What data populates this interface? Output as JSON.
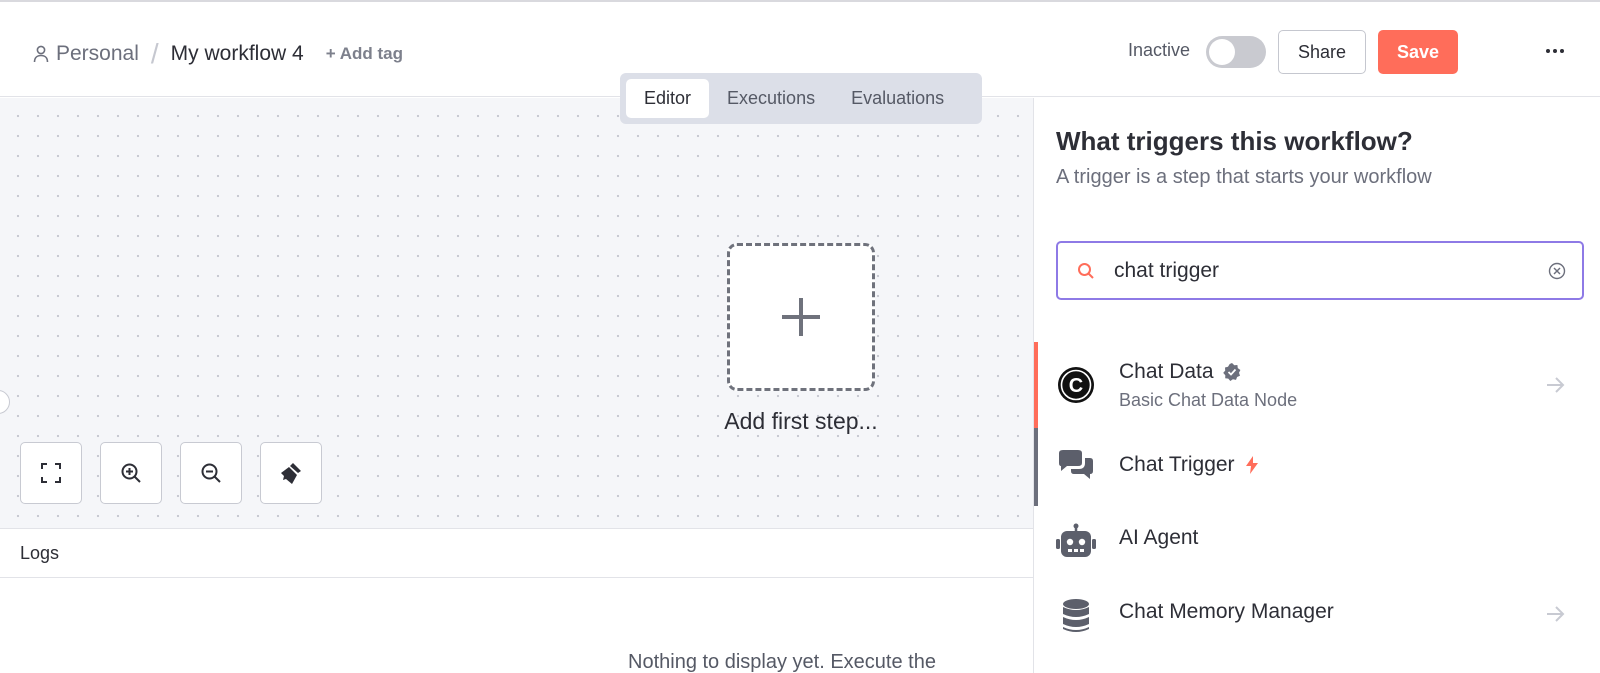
{
  "header": {
    "project": "Personal",
    "workflow_name": "My workflow 4",
    "add_tag": "+ Add tag",
    "status_label": "Inactive",
    "share_label": "Share",
    "save_label": "Save"
  },
  "tabs": [
    {
      "label": "Editor",
      "active": true
    },
    {
      "label": "Executions",
      "active": false
    },
    {
      "label": "Evaluations",
      "active": false
    }
  ],
  "canvas": {
    "add_first_step": "Add first step..."
  },
  "logs": {
    "title": "Logs",
    "empty_text": "Nothing to display yet. Execute the"
  },
  "panel": {
    "title": "What triggers this workflow?",
    "subtitle": "A trigger is a step that starts your workflow",
    "search_value": "chat trigger",
    "results": [
      {
        "name": "Chat Data",
        "description": "Basic Chat Data Node",
        "icon": "chat-data-logo-icon",
        "badge": "verified-icon"
      },
      {
        "name": "Chat Trigger",
        "description": "",
        "icon": "chat-bubbles-icon",
        "badge": "bolt-icon"
      },
      {
        "name": "AI Agent",
        "description": "",
        "icon": "robot-icon",
        "badge": ""
      },
      {
        "name": "Chat Memory Manager",
        "description": "",
        "icon": "database-icon",
        "badge": ""
      }
    ]
  },
  "colors": {
    "accent": "#ff6d5a",
    "search_border": "#8e7ae6",
    "tabs_bg": "#dcdfe8"
  }
}
